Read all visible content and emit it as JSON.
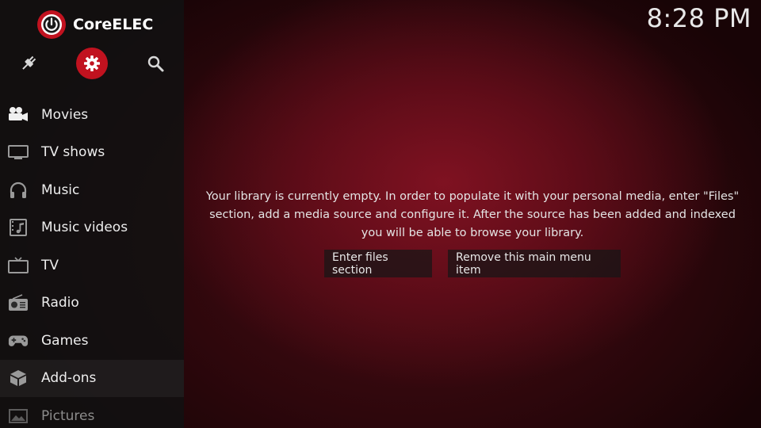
{
  "brand": {
    "name": "CoreELEC",
    "accent_color": "#c1121f"
  },
  "clock": {
    "time": "8:28 PM"
  },
  "top_icons": [
    {
      "icon": "power-plug-icon"
    },
    {
      "icon": "gear-icon",
      "active": true
    },
    {
      "icon": "search-icon"
    }
  ],
  "sidebar": {
    "items": [
      {
        "label": "Movies",
        "icon": "movie-camera-icon"
      },
      {
        "label": "TV shows",
        "icon": "monitor-icon"
      },
      {
        "label": "Music",
        "icon": "headphones-icon"
      },
      {
        "label": "Music videos",
        "icon": "music-video-icon"
      },
      {
        "label": "TV",
        "icon": "tv-icon"
      },
      {
        "label": "Radio",
        "icon": "radio-icon"
      },
      {
        "label": "Games",
        "icon": "gamepad-icon"
      },
      {
        "label": "Add-ons",
        "icon": "addons-box-icon"
      },
      {
        "label": "Pictures",
        "icon": "picture-icon"
      }
    ]
  },
  "main": {
    "message": "Your library is currently empty. In order to populate it with your personal media, enter \"Files\" section, add a media source and configure it. After the source has been added and indexed you will be able to browse your library.",
    "buttons": {
      "enter_files": "Enter files section",
      "remove_item": "Remove this main menu item"
    }
  }
}
